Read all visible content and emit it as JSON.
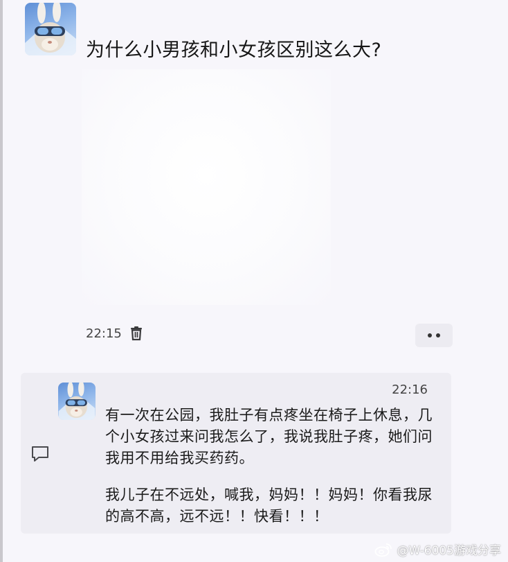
{
  "post": {
    "title": "为什么小男孩和小女孩区别这么大?",
    "time": "22:15",
    "avatar_icon": "rabbit-avatar-icon",
    "delete_icon": "trash-icon",
    "more_icon": "more-dots-icon"
  },
  "reply": {
    "time": "22:16",
    "avatar_icon": "rabbit-avatar-icon",
    "comment_icon": "comment-bubble-icon",
    "paragraphs": [
      "有一次在公园，我肚子有点疼坐在椅子上休息，几个小女孩过来问我怎么了，我说我肚子疼，她们问我用不用给我买药药。",
      "我儿子在不远处，喊我，妈妈！！妈妈！你看我尿的高不高，远不远！！快看！！！"
    ]
  },
  "watermark": {
    "text": "@W-6005游戏分享",
    "icon": "weibo-icon"
  },
  "colors": {
    "background": "#f7f6fb",
    "card": "#eeedf3",
    "text": "#1c1c1e",
    "meta": "#444444"
  }
}
